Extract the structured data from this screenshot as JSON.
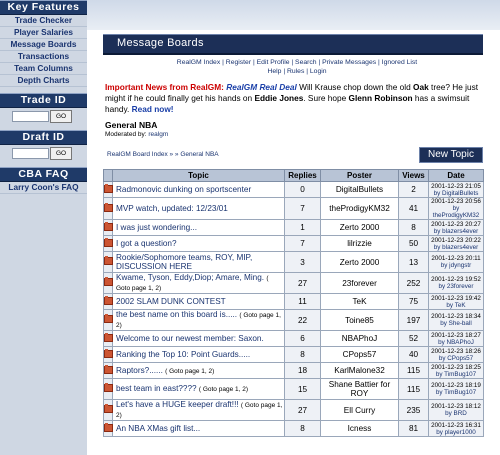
{
  "sidebar": {
    "key_features_title": "Key Features",
    "links": [
      "Trade Checker",
      "Player Salaries",
      "Message Boards",
      "Transactions",
      "Team Columns",
      "Depth Charts"
    ],
    "trade_id_title": "Trade ID",
    "draft_id_title": "Draft ID",
    "cba_faq_title": "CBA FAQ",
    "cba_link": "Larry Coon's FAQ",
    "go_label": "GO"
  },
  "header": {
    "title": "Message Boards"
  },
  "nav": {
    "line1": "RealGM Index | Register | Edit Profile | Search | Private Messages | Ignored List",
    "line2": "Help | Rules | Login"
  },
  "news": {
    "label": "Important News from RealGM:",
    "title": "RealGM Real Deal",
    "text1": " Will Krause chop down the old ",
    "bold1": "Oak",
    "text2": " tree? He just might if he could finally get his hands on ",
    "bold2": "Eddie Jones",
    "text3": ". Sure hope ",
    "bold3": "Glenn Robinson",
    "text4": " has a swimsuit handy. ",
    "read_now": "Read now!"
  },
  "forum": {
    "title": "General NBA",
    "moderated_label": "Moderated by: ",
    "moderator": "realgm",
    "breadcrumb": "RealGM Board Index » » General NBA",
    "new_topic": "New Topic"
  },
  "table": {
    "headers": {
      "topic": "Topic",
      "replies": "Replies",
      "poster": "Poster",
      "views": "Views",
      "date": "Date"
    },
    "rows": [
      {
        "topic": "Radmonovic dunking on sportscenter",
        "pages": "",
        "replies": "0",
        "poster": "DigitalBullets",
        "views": "2",
        "date": "2001-12-23 21:05",
        "by": "by DigitalBullets"
      },
      {
        "topic": "MVP watch, updated: 12/23/01",
        "pages": "",
        "replies": "7",
        "poster": "theProdigyKM32",
        "views": "41",
        "date": "2001-12-23 20:56",
        "by": "by theProdigyKM32"
      },
      {
        "topic": "I was just wondering...",
        "pages": "",
        "replies": "1",
        "poster": "Zerto 2000",
        "views": "8",
        "date": "2001-12-23 20:27",
        "by": "by blazers4ever"
      },
      {
        "topic": "I got a question?",
        "pages": "",
        "replies": "7",
        "poster": "lilrizzie",
        "views": "50",
        "date": "2001-12-23 20:22",
        "by": "by blazers4ever"
      },
      {
        "topic": "Rookie/Sophomore teams, ROY, MIP, DISCUSSION HERE",
        "pages": "",
        "replies": "3",
        "poster": "Zerto 2000",
        "views": "13",
        "date": "2001-12-23 20:11",
        "by": "by jdyngstr"
      },
      {
        "topic": "Kwame, Tyson, Eddy,Diop; Amare, Ming.",
        "pages": "( Goto page 1, 2)",
        "replies": "27",
        "poster": "23forever",
        "views": "252",
        "date": "2001-12-23 19:52",
        "by": "by 23forever"
      },
      {
        "topic": "2002 SLAM DUNK CONTEST",
        "pages": "",
        "replies": "11",
        "poster": "TeK",
        "views": "75",
        "date": "2001-12-23 19:42",
        "by": "by TeK"
      },
      {
        "topic": "the best name on this board is.....",
        "pages": "( Goto page 1, 2)",
        "replies": "22",
        "poster": "Toine85",
        "views": "197",
        "date": "2001-12-23 18:34",
        "by": "by She-ball"
      },
      {
        "topic": "Welcome to our newest member: Saxon.",
        "pages": "",
        "replies": "6",
        "poster": "NBAPhoJ",
        "views": "52",
        "date": "2001-12-23 18:27",
        "by": "by NBAPhoJ"
      },
      {
        "topic": "Ranking the Top 10: Point Guards.....",
        "pages": "",
        "replies": "8",
        "poster": "CPops57",
        "views": "40",
        "date": "2001-12-23 18:26",
        "by": "by CPops57"
      },
      {
        "topic": "Raptors?......",
        "pages": "( Goto page 1, 2)",
        "replies": "18",
        "poster": "KarlMalone32",
        "views": "115",
        "date": "2001-12-23 18:25",
        "by": "by TimBug107"
      },
      {
        "topic": "best team in east????",
        "pages": "( Goto page 1, 2)",
        "replies": "15",
        "poster": "Shane Battier for ROY",
        "views": "115",
        "date": "2001-12-23 18:19",
        "by": "by TimBug107"
      },
      {
        "topic": "Let's have a HUGE keeper draft!!!",
        "pages": "( Goto page 1, 2)",
        "replies": "27",
        "poster": "Ell Curry",
        "views": "235",
        "date": "2001-12-23 18:12",
        "by": "by BRD"
      },
      {
        "topic": "An NBA XMas gift list...",
        "pages": "",
        "replies": "8",
        "poster": "Icness",
        "views": "81",
        "date": "2001-12-23 16:31",
        "by": "by player1000"
      }
    ]
  }
}
